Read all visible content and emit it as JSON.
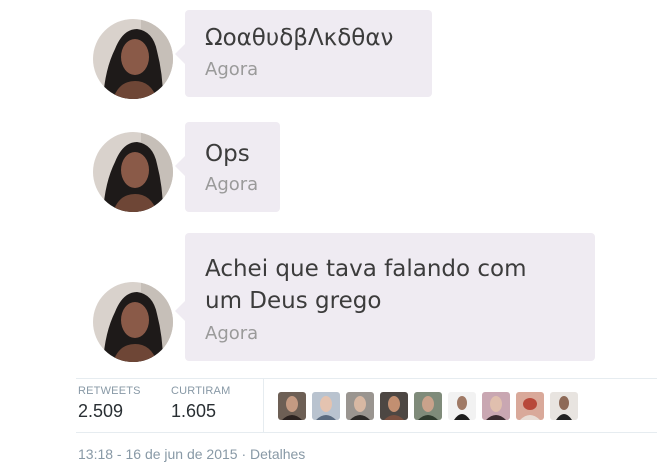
{
  "messages": [
    {
      "text": "ΩοαθυδβΛκδθαν",
      "time": "Agora"
    },
    {
      "text": "Ops",
      "time": "Agora"
    },
    {
      "text": "Achei que tava falando com\num Deus grego",
      "time": "Agora"
    }
  ],
  "stats": {
    "retweets_label": "RETWEETS",
    "retweets_value": "2.509",
    "likes_label": "CURTIRAM",
    "likes_value": "1.605"
  },
  "liker_count": 9,
  "footer": {
    "timestamp": "13:18 - 16 de jun de 2015",
    "separator": "·",
    "details_link": "Detalhes"
  },
  "colors": {
    "bubble": "#efebf2",
    "message_text": "#3c3c3c",
    "time_text": "#9a9a9a",
    "meta_text": "#8899a6"
  }
}
